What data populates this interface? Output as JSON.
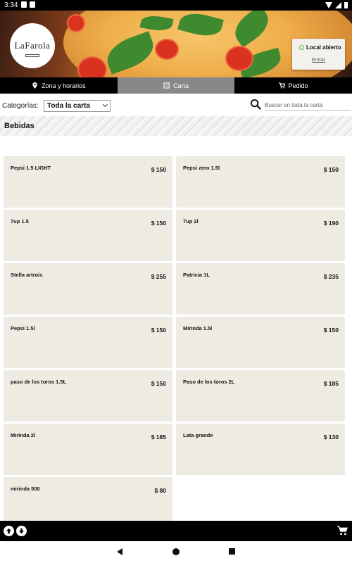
{
  "statusbar": {
    "time": "3:34"
  },
  "header": {
    "logo_text": "LaFarola",
    "status_label": "Local abierto",
    "login_link": "Entrar"
  },
  "tabs": [
    {
      "label": "Zona y horarios",
      "icon": "map-pin-icon"
    },
    {
      "label": "Carta",
      "icon": "menu-icon"
    },
    {
      "label": "Pedido",
      "icon": "cart-icon"
    }
  ],
  "filter": {
    "category_label": "Categorías:",
    "category_selected": "Toda la carta",
    "search_placeholder": "Buscar en toda la carta"
  },
  "section": {
    "title": "Bebidas"
  },
  "products": [
    {
      "name": "Pepsi 1.5 LIGHT",
      "price": "$ 150"
    },
    {
      "name": "Pepsi zero 1.5l",
      "price": "$ 150"
    },
    {
      "name": "7up 1.5",
      "price": "$ 150"
    },
    {
      "name": "7up 2l",
      "price": "$ 190"
    },
    {
      "name": "Stella artrois",
      "price": "$ 255"
    },
    {
      "name": "Patricia 1L",
      "price": "$ 235"
    },
    {
      "name": "Pepsi 1.5l",
      "price": "$ 150"
    },
    {
      "name": "Mirinda 1.5l",
      "price": "$ 150"
    },
    {
      "name": "paso de los toros 1.5L",
      "price": "$ 150"
    },
    {
      "name": "Paso de los toros 2L",
      "price": "$ 185"
    },
    {
      "name": "Mirinda 2l",
      "price": "$ 185"
    },
    {
      "name": "Lata grande",
      "price": "$ 130"
    },
    {
      "name": "mirinda 500",
      "price": "$ 80"
    }
  ],
  "colors": {
    "card_bg": "#eeebe3",
    "tab_active": "#888888",
    "open_green": "#5bb14a"
  }
}
